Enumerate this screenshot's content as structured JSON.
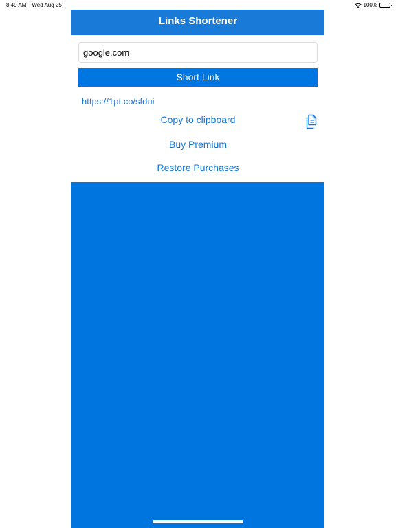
{
  "status_bar": {
    "time": "8:49 AM",
    "date": "Wed Aug 25",
    "battery": "100%",
    "battery_level": 1.0
  },
  "nav": {
    "title": "Links Shortener"
  },
  "form": {
    "url_value": "google.com",
    "short_button_label": "Short Link"
  },
  "result": {
    "short_url": "https://1pt.co/sfdui",
    "copy_label": "Copy to clipboard",
    "copy_icon": "clipboard-icon"
  },
  "actions": {
    "buy_premium": "Buy Premium",
    "restore_purchases": "Restore Purchases"
  },
  "colors": {
    "nav_bar": "#1a7ad8",
    "accent": "#0077e0",
    "link": "#1677d6",
    "panel": "#0075e0"
  }
}
